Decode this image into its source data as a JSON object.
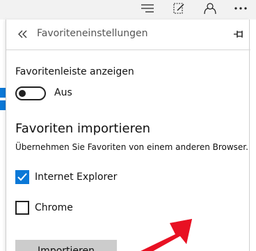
{
  "toolbar": {
    "icons": [
      "hub-icon",
      "web-note-icon",
      "share-icon",
      "more-icon"
    ]
  },
  "panel": {
    "title": "Favoriteneinstellungen"
  },
  "favorites_bar": {
    "label": "Favoritenleiste anzeigen",
    "toggle_state_text": "Aus",
    "enabled": false
  },
  "import_section": {
    "title": "Favoriten importieren",
    "description": "Übernehmen Sie Favoriten von einem anderen Browser.",
    "browsers": [
      {
        "label": "Internet Explorer",
        "checked": true
      },
      {
        "label": "Chrome",
        "checked": false
      }
    ],
    "button_label": "Importieren"
  },
  "colors": {
    "accent": "#0a78d7",
    "annotation_arrow": "#e81123",
    "button_bg": "#cccccc"
  }
}
